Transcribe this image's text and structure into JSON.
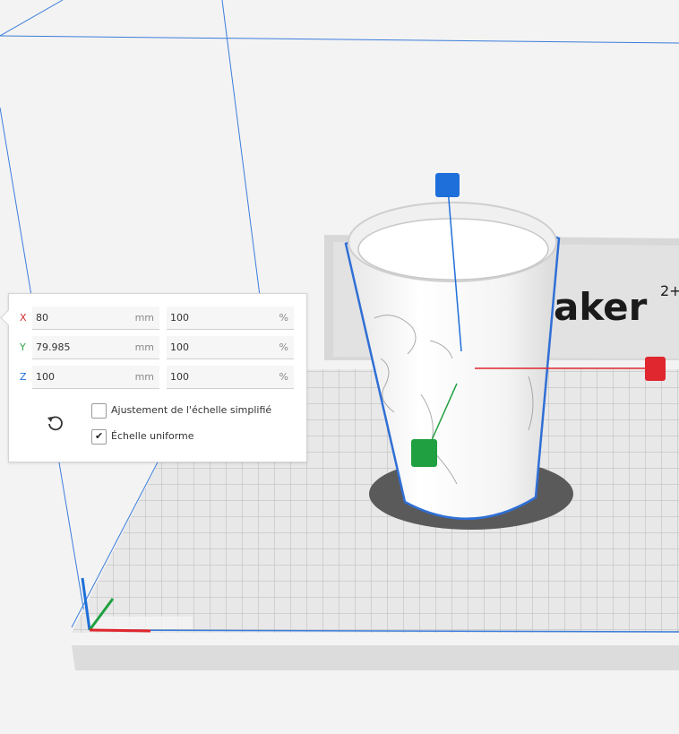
{
  "viewport": {
    "brand_text": "aker",
    "brand_superscript": "2+"
  },
  "scale_panel": {
    "rows": [
      {
        "axis": "X",
        "axis_color": "#d32f2f",
        "mm_value": "80",
        "mm_unit": "mm",
        "pct_value": "100",
        "pct_unit": "%"
      },
      {
        "axis": "Y",
        "axis_color": "#2e9e45",
        "mm_value": "79.985",
        "mm_unit": "mm",
        "pct_value": "100",
        "pct_unit": "%"
      },
      {
        "axis": "Z",
        "axis_color": "#1e6fd9",
        "mm_value": "100",
        "mm_unit": "mm",
        "pct_value": "100",
        "pct_unit": "%"
      }
    ],
    "snap_scaling_label": "Ajustement de l'échelle simplifié",
    "snap_scaling_checked": false,
    "uniform_scaling_label": "Échelle uniforme",
    "uniform_scaling_checked": true,
    "reset_icon": "reset-rotate-icon"
  },
  "colors": {
    "selection_outline": "#2f6fd6",
    "handle_x": "#e0262f",
    "handle_y": "#20a040",
    "handle_z": "#1e6fd9"
  }
}
